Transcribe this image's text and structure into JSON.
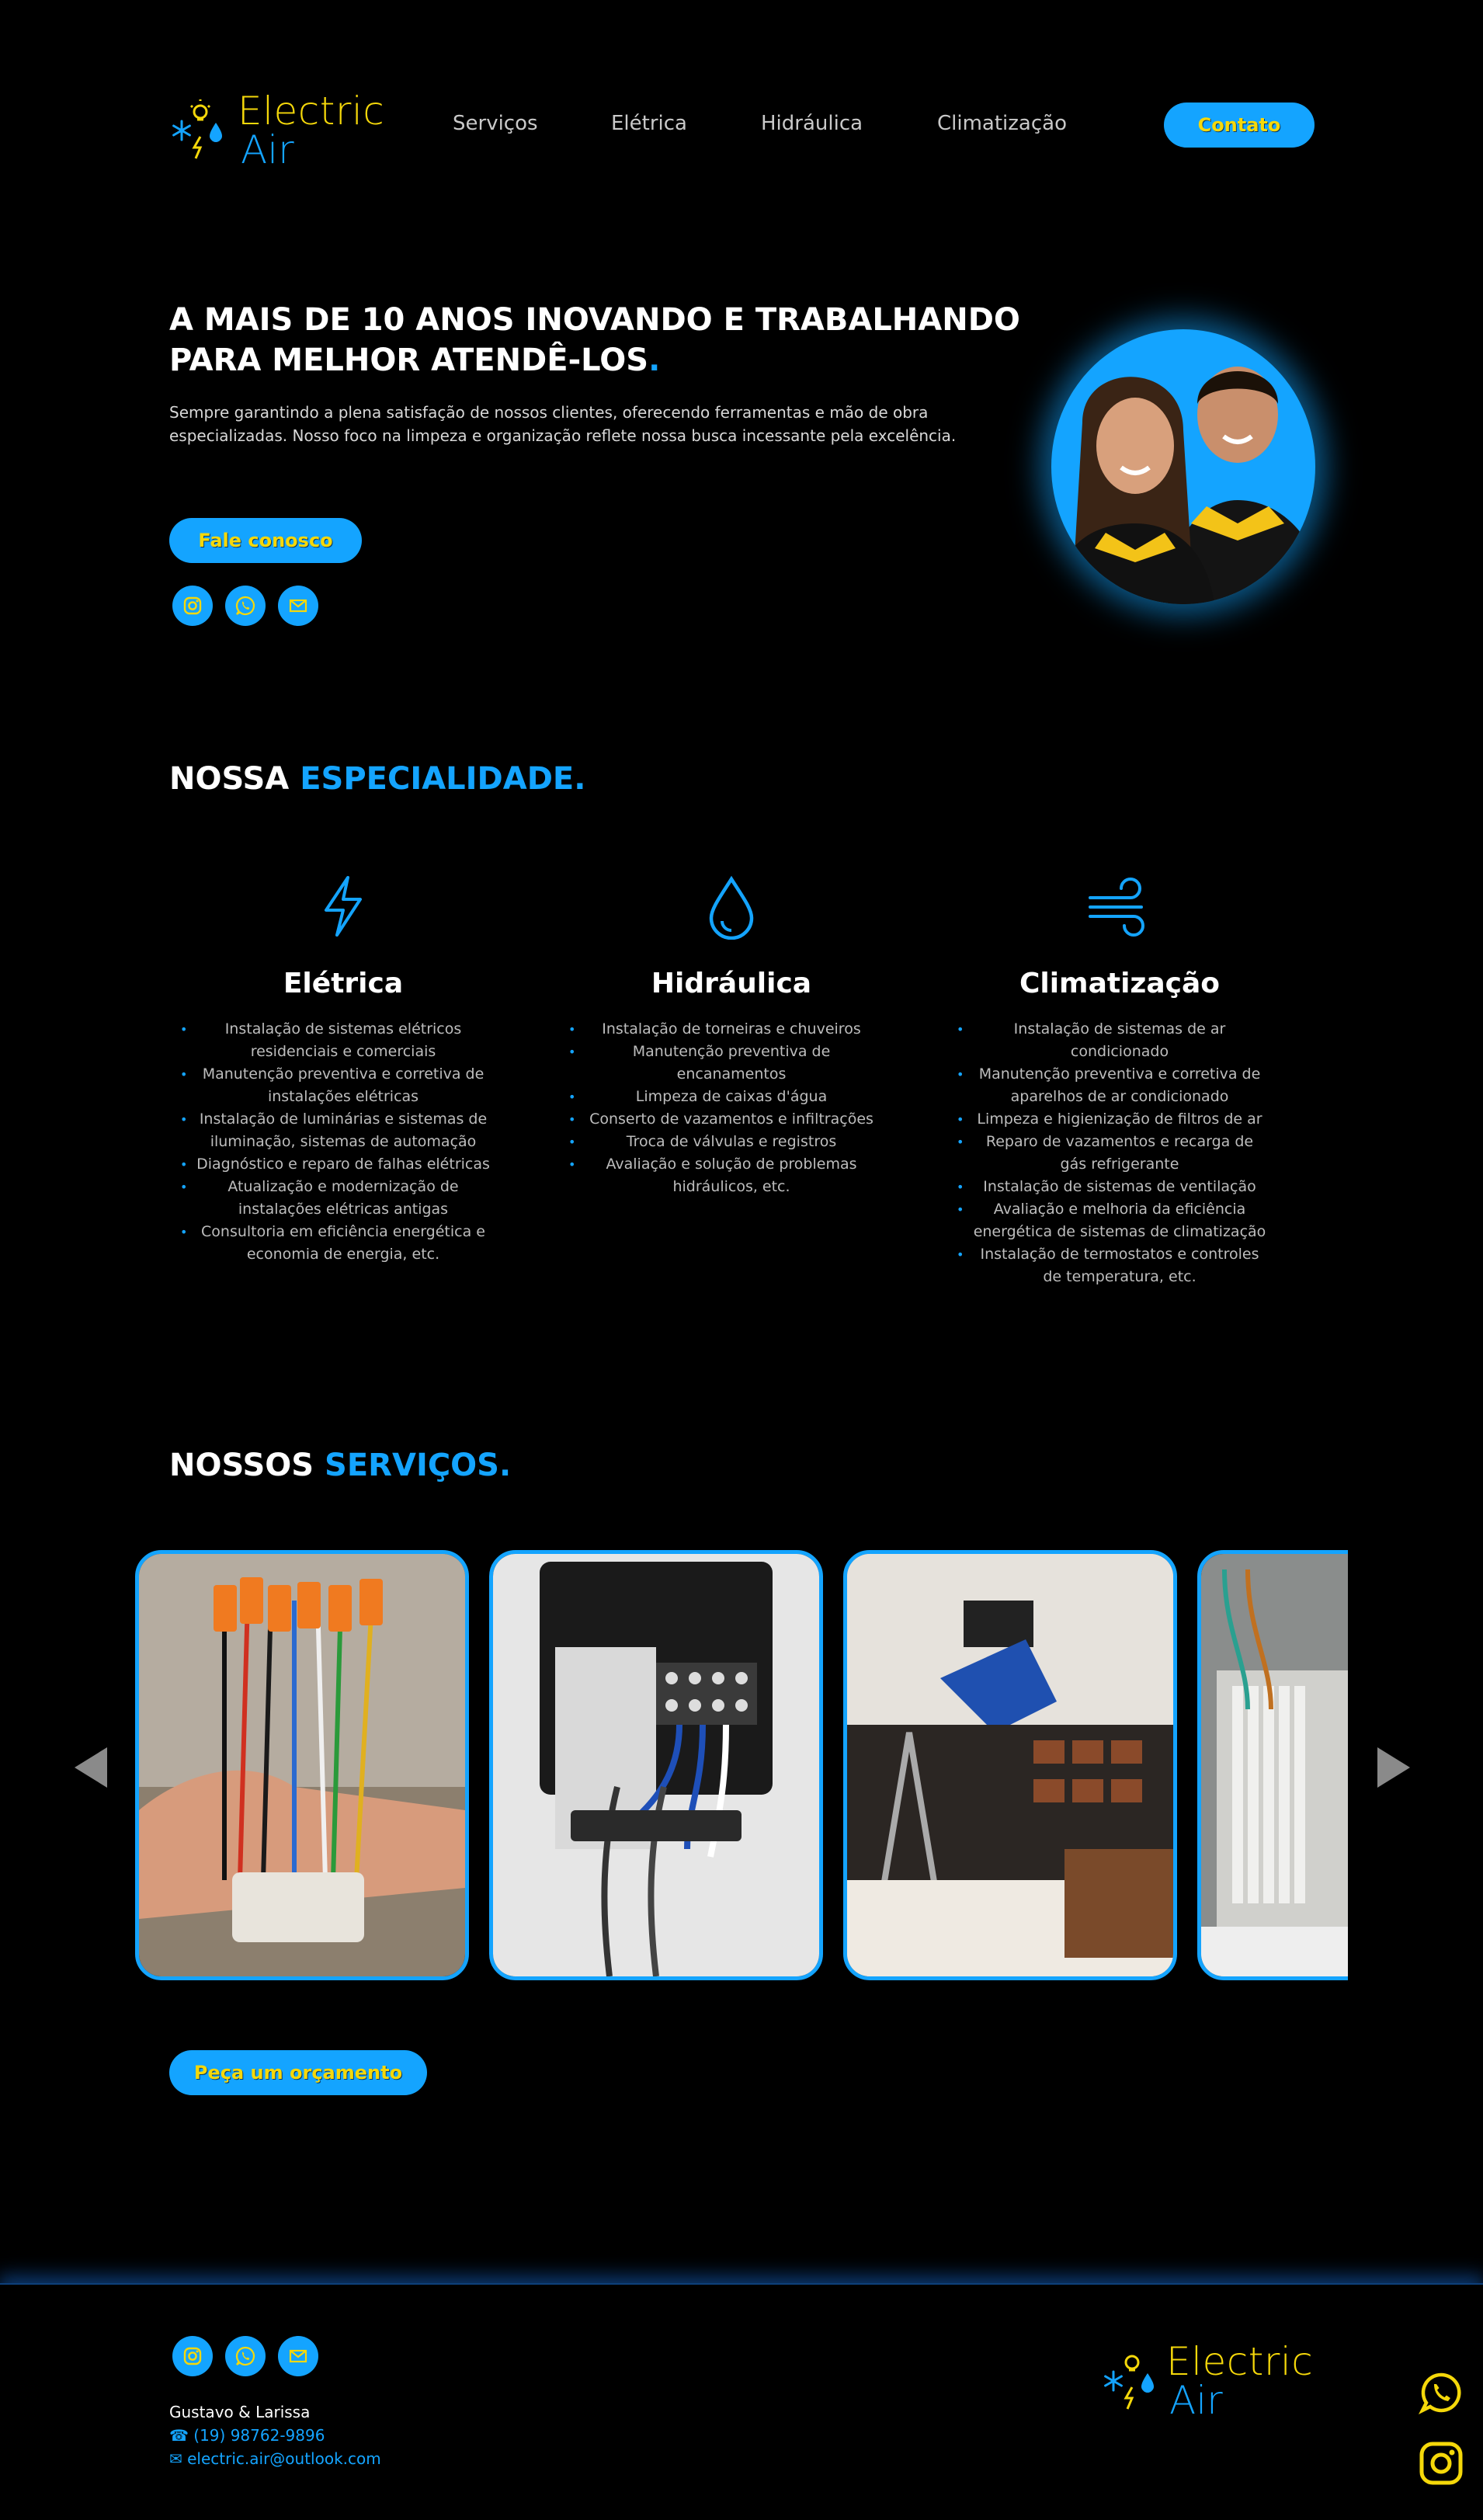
{
  "brand": {
    "line1": "Electric",
    "line2": "Air"
  },
  "nav": [
    {
      "label": "Serviços"
    },
    {
      "label": "Elétrica"
    },
    {
      "label": "Hidráulica"
    },
    {
      "label": "Climatização"
    }
  ],
  "header": {
    "contact_label": "Contato"
  },
  "hero": {
    "title": "A MAIS DE 10 ANOS INOVANDO E TRABALHANDO PARA MELHOR ATENDÊ-LOS",
    "title_dot": ".",
    "text": "Sempre garantindo a plena satisfação de nossos clientes, oferecendo ferramentas e mão de obra especializadas. Nosso foco na limpeza e organização reflete nossa busca incessante pela excelência.",
    "cta_label": "Fale conosco"
  },
  "social_icons": [
    "instagram-icon",
    "whatsapp-icon",
    "mail-icon"
  ],
  "specialty": {
    "title_a": "NOSSA ",
    "title_b": "ESPECIALIDADE.",
    "columns": [
      {
        "icon": "lightning-icon",
        "title": "Elétrica",
        "items": [
          "Instalação de sistemas elétricos residenciais e comerciais",
          "Manutenção preventiva e corretiva de instalações elétricas",
          "Instalação de luminárias e sistemas de iluminação, sistemas de automação",
          "Diagnóstico e reparo de falhas elétricas",
          "Atualização e modernização de instalações elétricas antigas",
          "Consultoria em eficiência energética e economia de energia, etc."
        ]
      },
      {
        "icon": "water-drop-icon",
        "title": "Hidráulica",
        "items": [
          "Instalação de torneiras e chuveiros",
          "Manutenção preventiva de encanamentos",
          "Limpeza de caixas d'água",
          "Conserto de vazamentos e infiltrações",
          "Troca de válvulas e registros",
          "Avaliação e solução de problemas hidráulicos, etc."
        ]
      },
      {
        "icon": "wind-icon",
        "title": "Climatização",
        "items": [
          "Instalação de sistemas de ar condicionado",
          "Manutenção preventiva e corretiva de aparelhos de ar condicionado",
          "Limpeza e higienização de filtros de ar",
          "Reparo de vazamentos e recarga de gás refrigerante",
          "Instalação de sistemas de ventilação",
          "Avaliação e melhoria da eficiência energética de sistemas de climatização",
          "Instalação de termostatos e controles de temperatura, etc."
        ]
      }
    ]
  },
  "services": {
    "title_a": "NOSSOS ",
    "title_b": "SERVIÇOS.",
    "cta_label": "Peça um orçamento"
  },
  "footer": {
    "names": "Gustavo & Larissa",
    "phone": "(19) 98762-9896",
    "email": "electric.air@outlook.com"
  },
  "colors": {
    "accent": "#14a4ff",
    "brand_yellow": "#f5d80a",
    "background": "#000000"
  }
}
